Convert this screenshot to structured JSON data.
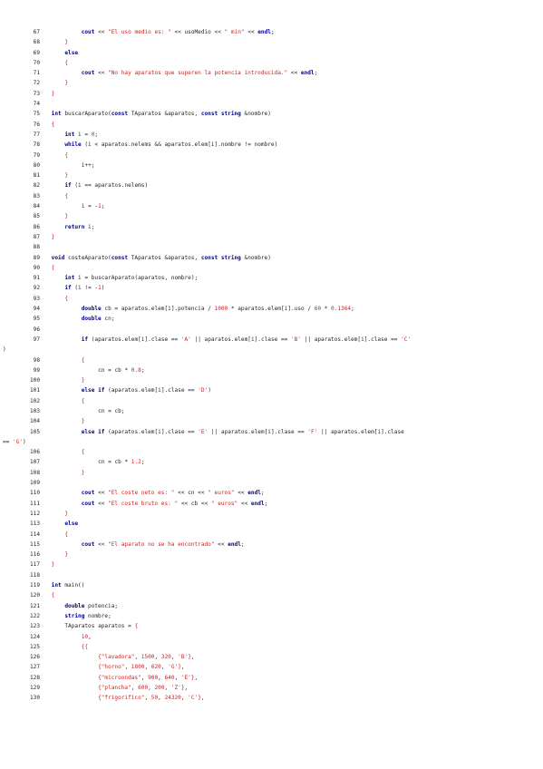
{
  "document": {
    "lines": [
      {
        "num": "67",
        "code": "          cout << \"El uso medio es: \" << usoMedio << \" min\" << endl;"
      },
      {
        "num": "68",
        "code": "     }"
      },
      {
        "num": "69",
        "code": "     else"
      },
      {
        "num": "70",
        "code": "     {"
      },
      {
        "num": "71",
        "code": "          cout << \"No hay aparatos que superen la potencia introducida.\" << endl;"
      },
      {
        "num": "72",
        "code": "     }"
      },
      {
        "num": "73",
        "code": " }"
      },
      {
        "num": "74",
        "code": ""
      },
      {
        "num": "75",
        "code": " int buscarAparato(const TAparatos &aparatos, const string &nombre)"
      },
      {
        "num": "76",
        "code": " {"
      },
      {
        "num": "77",
        "code": "     int i = 0;"
      },
      {
        "num": "78",
        "code": "     while (i < aparatos.nelems && aparatos.elem[i].nombre != nombre)"
      },
      {
        "num": "79",
        "code": "     {"
      },
      {
        "num": "80",
        "code": "          i++;"
      },
      {
        "num": "81",
        "code": "     }"
      },
      {
        "num": "82",
        "code": "     if (i == aparatos.nelems)"
      },
      {
        "num": "83",
        "code": "     {"
      },
      {
        "num": "84",
        "code": "          i = -1;"
      },
      {
        "num": "85",
        "code": "     }"
      },
      {
        "num": "86",
        "code": "     return i;"
      },
      {
        "num": "87",
        "code": " }"
      },
      {
        "num": "88",
        "code": ""
      },
      {
        "num": "89",
        "code": " void costeAparato(const TAparatos &aparatos, const string &nombre)"
      },
      {
        "num": "90",
        "code": " {"
      },
      {
        "num": "91",
        "code": "     int i = buscarAparato(aparatos, nombre);"
      },
      {
        "num": "92",
        "code": "     if (i != -1)"
      },
      {
        "num": "93",
        "code": "     {"
      },
      {
        "num": "94",
        "code": "          double cb = aparatos.elem[i].potencia / 1000 * aparatos.elem[i].uso / 60 * 0.1364;"
      },
      {
        "num": "95",
        "code": "          double cn;"
      },
      {
        "num": "96",
        "code": ""
      },
      {
        "num": "97",
        "code": "          if (aparatos.elem[i].clase == 'A' || aparatos.elem[i].clase == 'B' || aparatos.elem[i].clase == 'C'"
      },
      {
        "num": "",
        "code": ")",
        "wrap": true
      },
      {
        "num": "98",
        "code": "          {"
      },
      {
        "num": "99",
        "code": "               cn = cb * 0.8;"
      },
      {
        "num": "100",
        "code": "          }"
      },
      {
        "num": "101",
        "code": "          else if (aparatos.elem[i].clase == 'D')"
      },
      {
        "num": "102",
        "code": "          {"
      },
      {
        "num": "103",
        "code": "               cn = cb;"
      },
      {
        "num": "104",
        "code": "          }"
      },
      {
        "num": "105",
        "code": "          else if (aparatos.elem[i].clase == 'E' || aparatos.elem[i].clase == 'F' || aparatos.elem[i].clase"
      },
      {
        "num": "",
        "code": "== 'G')",
        "wrap": true
      },
      {
        "num": "106",
        "code": "          {"
      },
      {
        "num": "107",
        "code": "               cn = cb * 1.2;"
      },
      {
        "num": "108",
        "code": "          }"
      },
      {
        "num": "109",
        "code": ""
      },
      {
        "num": "110",
        "code": "          cout << \"El coste neto es: \" << cn << \" euros\" << endl;"
      },
      {
        "num": "111",
        "code": "          cout << \"El coste bruto es: \" << cb << \" euros\" << endl;"
      },
      {
        "num": "112",
        "code": "     }"
      },
      {
        "num": "113",
        "code": "     else"
      },
      {
        "num": "114",
        "code": "     {"
      },
      {
        "num": "115",
        "code": "          cout << \"El aparato no se ha encontrado\" << endl;"
      },
      {
        "num": "116",
        "code": "     }"
      },
      {
        "num": "117",
        "code": " }"
      },
      {
        "num": "118",
        "code": ""
      },
      {
        "num": "119",
        "code": " int main()"
      },
      {
        "num": "120",
        "code": " {"
      },
      {
        "num": "121",
        "code": "     double potencia;"
      },
      {
        "num": "122",
        "code": "     string nombre;"
      },
      {
        "num": "123",
        "code": "     TAparatos aparatos = {"
      },
      {
        "num": "124",
        "code": "          10,"
      },
      {
        "num": "125",
        "code": "          {{"
      },
      {
        "num": "126",
        "code": "               {\"lavadora\", 1500, 320, 'B'},"
      },
      {
        "num": "127",
        "code": "               {\"horno\", 1800, 620, 'G'},"
      },
      {
        "num": "128",
        "code": "               {\"microondas\", 900, 640, 'E'},"
      },
      {
        "num": "129",
        "code": "               {\"plancha\", 600, 200, 'Z'},"
      },
      {
        "num": "130",
        "code": "               {\"frigorifico\", 50, 24320, 'C'},"
      }
    ]
  }
}
